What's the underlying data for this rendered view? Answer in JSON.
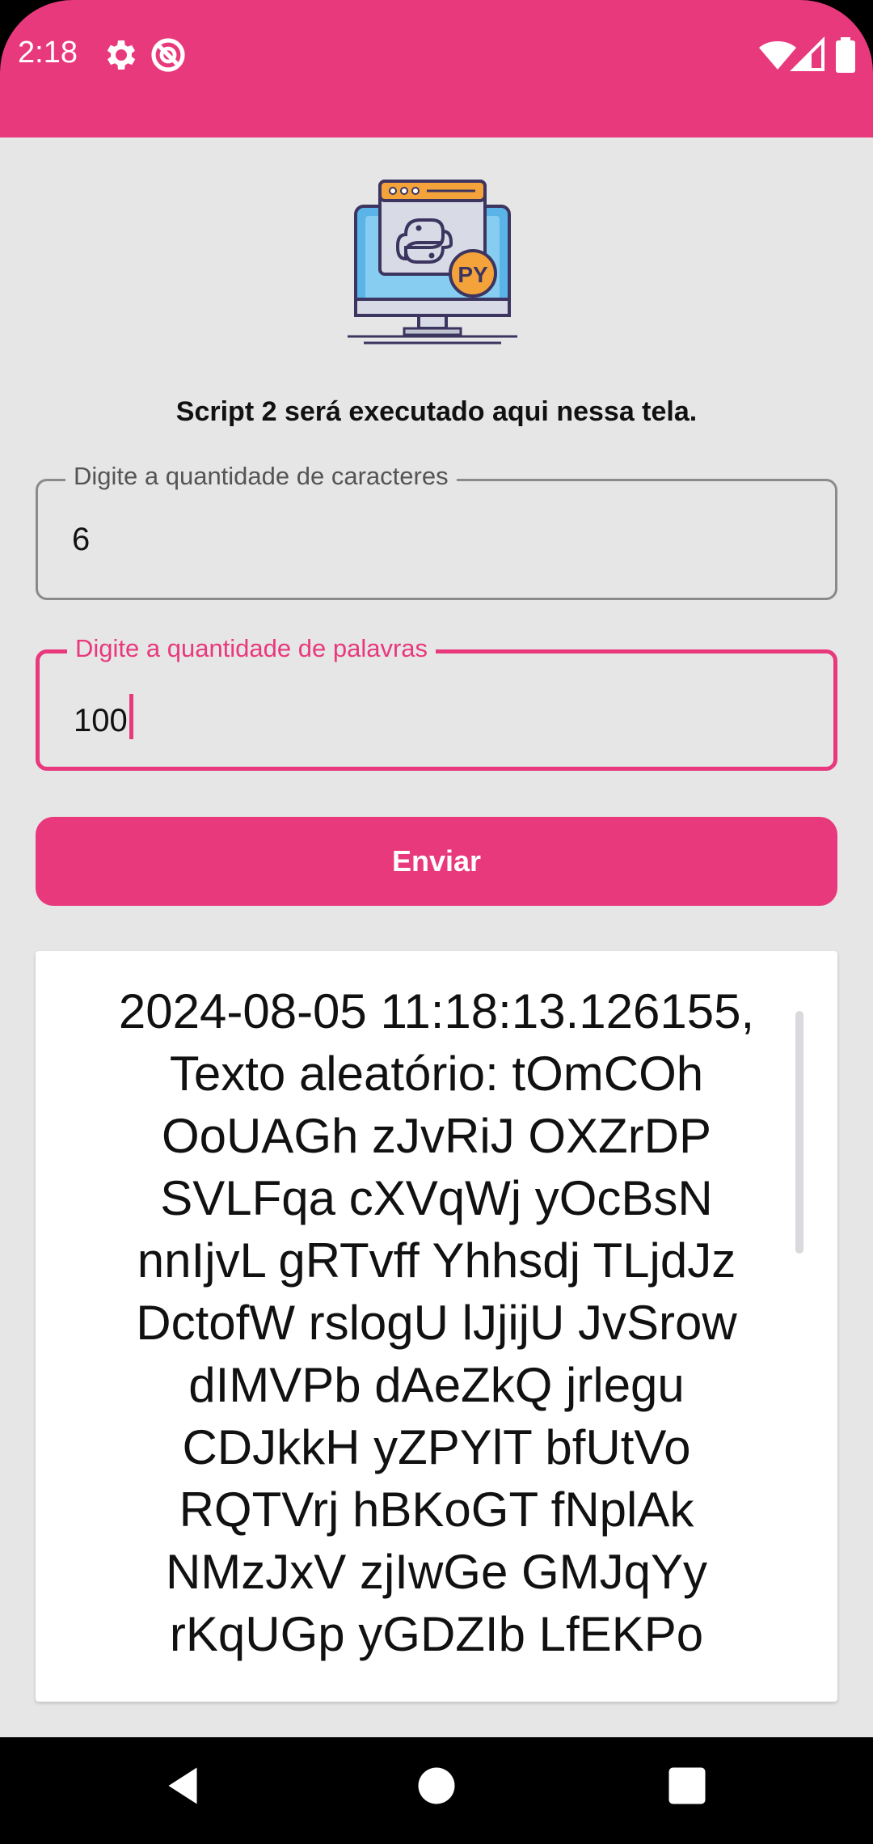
{
  "status_bar": {
    "time": "2:18",
    "icons": [
      "gear-icon",
      "no-disturb-icon",
      "wifi-icon",
      "signal-icon",
      "battery-icon"
    ],
    "color": "#e8397d"
  },
  "header": {
    "logo_icon": "python-monitor-logo-icon",
    "logo_badge": "PY",
    "subtitle": "Script 2 será executado aqui nessa tela."
  },
  "form": {
    "characters_field": {
      "label": "Digite a quantidade de caracteres",
      "value": "6"
    },
    "words_field": {
      "label": "Digite a quantidade de palavras",
      "value": "100"
    },
    "send_label": "Enviar"
  },
  "output": {
    "text": "2024-08-05 11:18:13.126155,\nTexto aleatório: tOmCOh\nOoUAGh zJvRiJ OXZrDP\nSVLFqa cXVqWj yOcBsN\nnnIjvL gRTvff Yhhsdj TLjdJz\nDctofW rslogU lJjijU JvSrow\ndIMVPb dAeZkQ jrlegu\nCDJkkH yZPYlT bfUtVo\nRQTVrj hBKoGT fNplAk\nNMzJxV zjIwGe GMJqYy\nrKqUGp yGDZIb LfEKPo"
  },
  "nav_bar": {
    "icons": [
      "back-icon",
      "home-icon",
      "recents-icon"
    ]
  },
  "colors": {
    "accent": "#e8397d",
    "background": "#e6e6e6",
    "card": "#ffffff"
  }
}
